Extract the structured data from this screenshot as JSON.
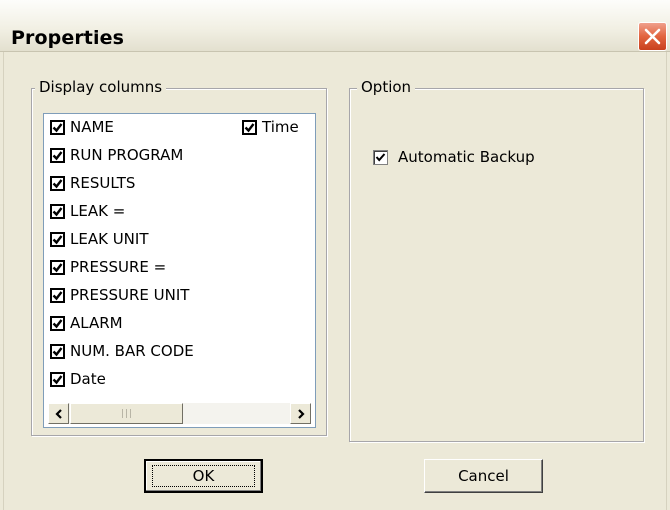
{
  "window": {
    "title": "Properties"
  },
  "display_columns": {
    "legend": "Display columns",
    "items": [
      {
        "label": "NAME",
        "checked": true
      },
      {
        "label": "RUN PROGRAM",
        "checked": true
      },
      {
        "label": "RESULTS",
        "checked": true
      },
      {
        "label": "LEAK =",
        "checked": true
      },
      {
        "label": "LEAK UNIT",
        "checked": true
      },
      {
        "label": "PRESSURE =",
        "checked": true
      },
      {
        "label": "PRESSURE UNIT",
        "checked": true
      },
      {
        "label": "ALARM",
        "checked": true
      },
      {
        "label": "NUM. BAR CODE",
        "checked": true
      },
      {
        "label": "Date",
        "checked": true
      },
      {
        "label": "Time",
        "checked": true
      }
    ]
  },
  "option": {
    "legend": "Option",
    "automatic_backup": {
      "label": "Automatic Backup",
      "checked": true
    }
  },
  "buttons": {
    "ok": "OK",
    "cancel": "Cancel"
  }
}
